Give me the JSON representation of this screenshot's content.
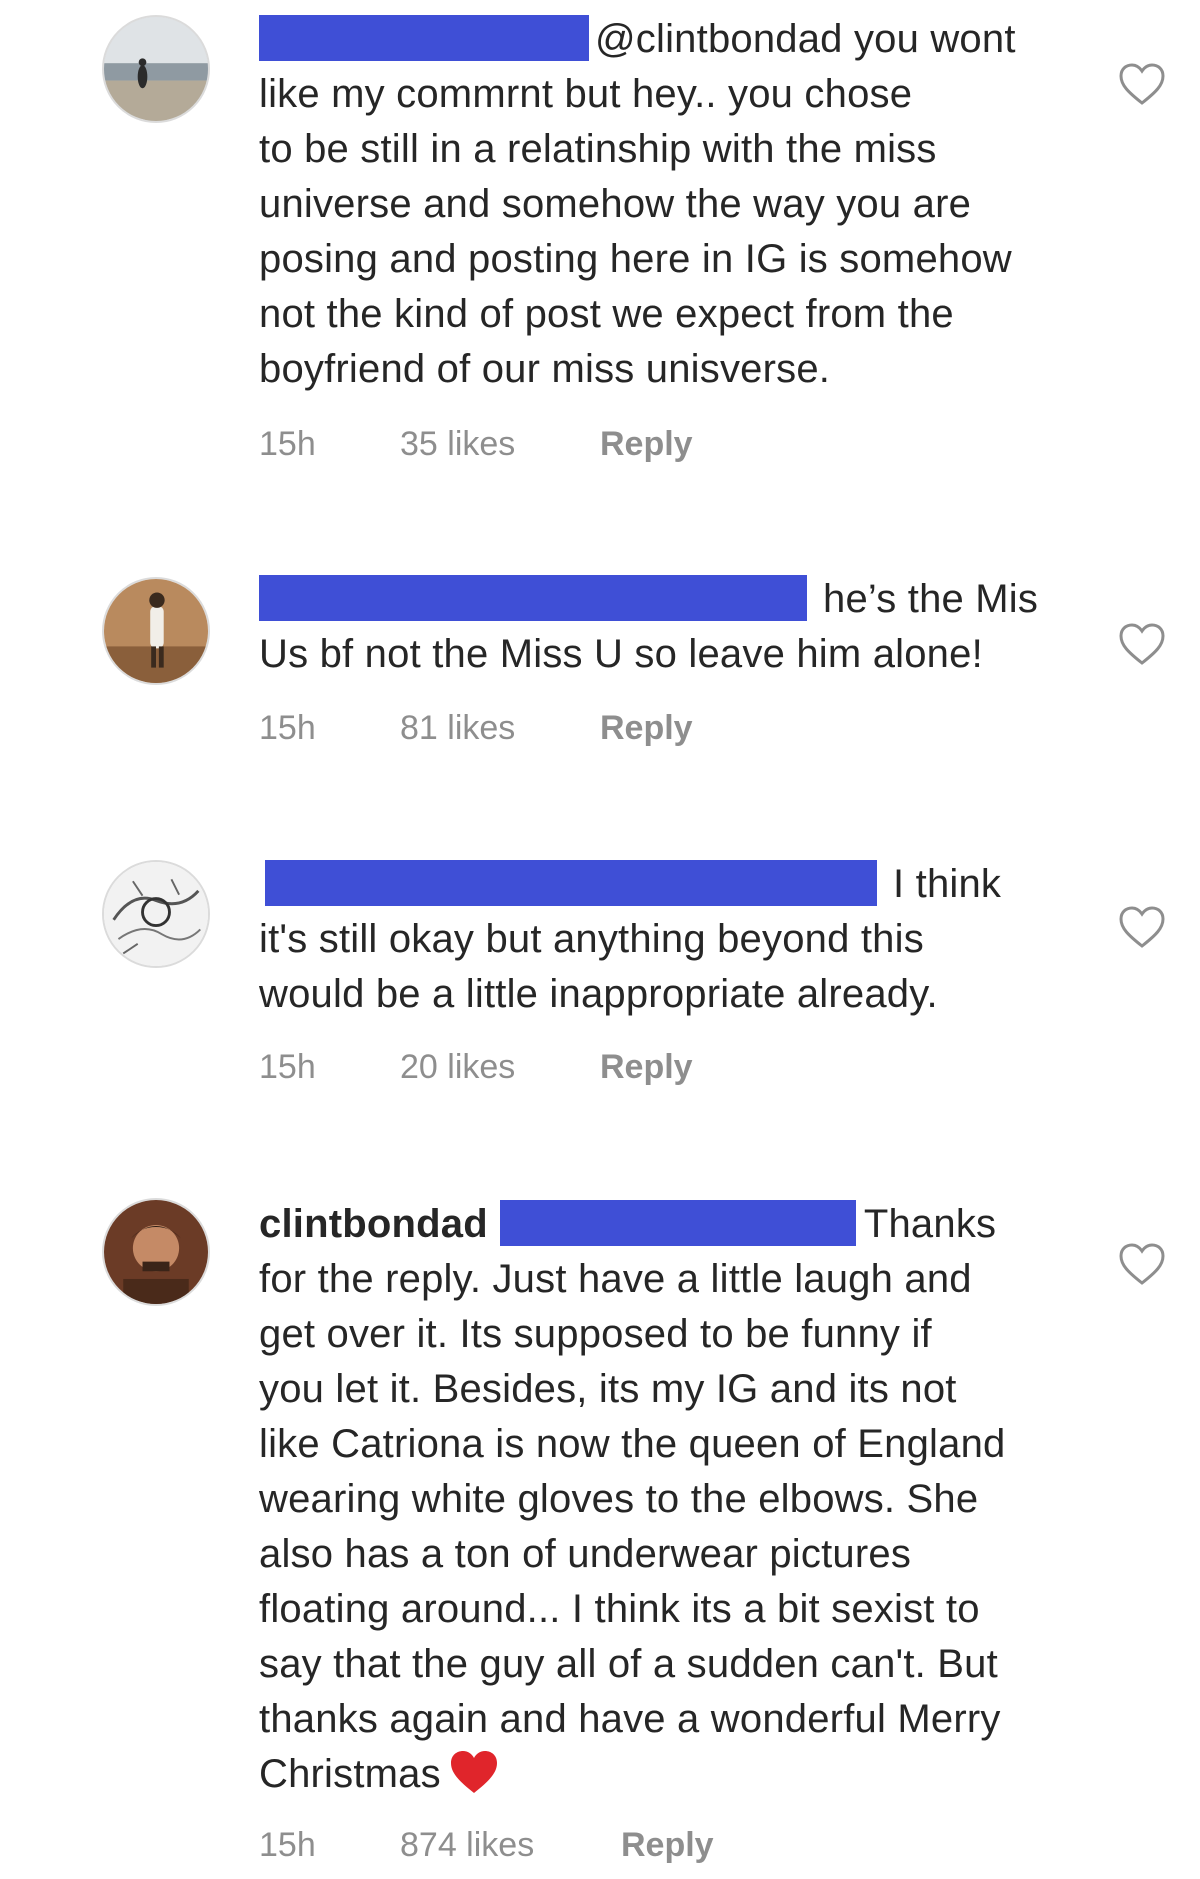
{
  "comments": [
    {
      "lines": [
        {
          "mention": "@clintbondad",
          "text": " you wont"
        },
        {
          "text": "like my commrnt but hey.. you chose"
        },
        {
          "text": "to be still in a relatinship with the miss"
        },
        {
          "text": "universe and somehow the way you are"
        },
        {
          "text": "posing and posting here in IG is somehow"
        },
        {
          "text": "not the kind of post we expect from the"
        },
        {
          "text": "boyfriend of our miss unisverse."
        }
      ],
      "time": "15h",
      "likes": "35 likes",
      "reply": "Reply"
    },
    {
      "lines": [
        {
          "text": "he’s the Mis"
        },
        {
          "text": "Us bf not the Miss U so leave him alone!"
        }
      ],
      "time": "15h",
      "likes": "81 likes",
      "reply": "Reply"
    },
    {
      "lines": [
        {
          "text": "I think"
        },
        {
          "text": "it's still okay but anything beyond this"
        },
        {
          "text": "would be a little inappropriate already."
        }
      ],
      "time": "15h",
      "likes": "20 likes",
      "reply": "Reply"
    },
    {
      "username": "clintbondad",
      "lines": [
        {
          "text": "Thanks"
        },
        {
          "text": "for the reply. Just have a little laugh and"
        },
        {
          "text": "get over it. Its supposed to be funny if"
        },
        {
          "text": "you let it. Besides, its my IG and its not"
        },
        {
          "text": "like Catriona is now the queen of England"
        },
        {
          "text": "wearing white gloves to the elbows. She"
        },
        {
          "text": "also has a ton of underwear pictures"
        },
        {
          "text": "floating around... I think its a bit sexist to"
        },
        {
          "text": "say that the guy all of a sudden can't. But"
        },
        {
          "text": "thanks again and have a wonderful Merry"
        },
        {
          "text": "Christmas"
        }
      ],
      "time": "15h",
      "likes": "874 likes",
      "reply": "Reply"
    }
  ],
  "icons": {
    "like": "heart-outline-icon",
    "emoji": "red-heart-emoji"
  },
  "colors": {
    "redaction": "#3f4fd6",
    "text": "#262626",
    "meta": "#8e8e8e",
    "heart_emoji": "#e0252b"
  }
}
